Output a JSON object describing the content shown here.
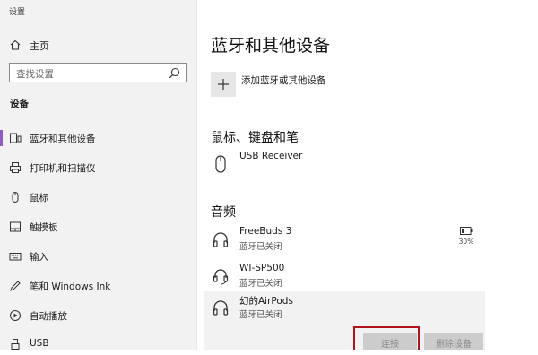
{
  "window": {
    "title": "设置"
  },
  "sidebar": {
    "home_label": "主页",
    "search_placeholder": "查找设置",
    "section_header": "设备",
    "items": [
      {
        "label": "蓝牙和其他设备",
        "icon": "bluetooth-devices-icon",
        "selected": true
      },
      {
        "label": "打印机和扫描仪",
        "icon": "printer-icon"
      },
      {
        "label": "鼠标",
        "icon": "mouse-icon"
      },
      {
        "label": "触摸板",
        "icon": "touchpad-icon"
      },
      {
        "label": "输入",
        "icon": "keyboard-icon"
      },
      {
        "label": "笔和 Windows Ink",
        "icon": "pen-icon"
      },
      {
        "label": "自动播放",
        "icon": "autoplay-icon"
      },
      {
        "label": "USB",
        "icon": "usb-icon"
      }
    ],
    "accent_color": "#8d5fc4"
  },
  "main": {
    "title": "蓝牙和其他设备",
    "add_device_label": "添加蓝牙或其他设备",
    "groups": [
      {
        "title": "鼠标、键盘和笔",
        "devices": [
          {
            "name": "USB Receiver",
            "status": "",
            "icon": "mouse-icon"
          }
        ]
      },
      {
        "title": "音频",
        "devices": [
          {
            "name": "FreeBuds 3",
            "status": "蓝牙已关闭",
            "icon": "headphones-icon",
            "battery": "30%"
          },
          {
            "name": "WI-SP500",
            "status": "蓝牙已关闭",
            "icon": "headset-icon"
          },
          {
            "name": "幻的AirPods",
            "status": "蓝牙已关闭",
            "icon": "headphones-icon",
            "selected": true
          }
        ]
      }
    ],
    "buttons": {
      "connect": "连接",
      "remove": "删除设备"
    },
    "highlight_color": "#b3141b"
  }
}
